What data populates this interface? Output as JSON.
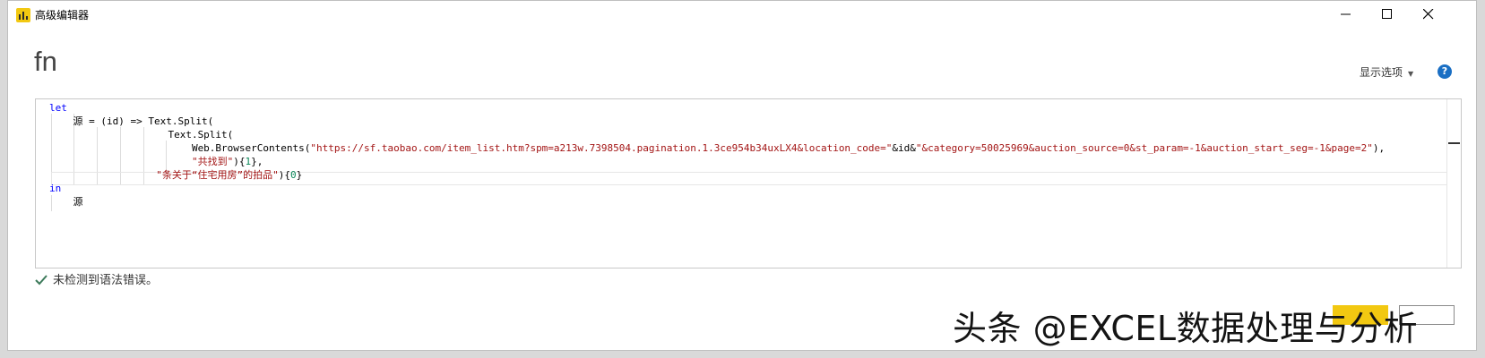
{
  "window": {
    "title": "高级编辑器",
    "minimize_icon": "minimize-icon",
    "maximize_icon": "maximize-icon",
    "close_icon": "close-icon"
  },
  "header": {
    "fn_label": "fn",
    "display_options": "显示选项",
    "help_glyph": "?"
  },
  "editor": {
    "lines": [
      {
        "seg": [
          {
            "t": "let",
            "c": "kw"
          }
        ]
      },
      {
        "seg": [
          {
            "t": "    源 = (id) => Text.Split(",
            "c": ""
          }
        ]
      },
      {
        "seg": [
          {
            "t": "                    Text.Split(",
            "c": ""
          }
        ]
      },
      {
        "seg": [
          {
            "t": "                        Web.BrowserContents(",
            "c": ""
          },
          {
            "t": "\"https://sf.taobao.com/item_list.htm?spm=a213w.7398504.pagination.1.3ce954b34uxLX4&location_code=\"",
            "c": "str"
          },
          {
            "t": "&id&",
            "c": ""
          },
          {
            "t": "\"&category=50025969&auction_source=0&st_param=-1&auction_start_seg=-1&page=2\"",
            "c": "str"
          },
          {
            "t": "),",
            "c": ""
          }
        ]
      },
      {
        "seg": [
          {
            "t": "                        ",
            "c": ""
          },
          {
            "t": "\"共找到\"",
            "c": "str"
          },
          {
            "t": "){",
            "c": ""
          },
          {
            "t": "1",
            "c": "num"
          },
          {
            "t": "},",
            "c": ""
          }
        ]
      },
      {
        "seg": [
          {
            "t": "                  ",
            "c": ""
          },
          {
            "t": "\"条关于“住宅用房”的拍品\"",
            "c": "str"
          },
          {
            "t": "){",
            "c": ""
          },
          {
            "t": "0",
            "c": "num"
          },
          {
            "t": "}",
            "c": ""
          }
        ]
      },
      {
        "seg": [
          {
            "t": "in",
            "c": "kw"
          }
        ]
      },
      {
        "seg": [
          {
            "t": "    源",
            "c": ""
          }
        ]
      }
    ]
  },
  "status": {
    "check_icon": "checkmark-icon",
    "text": "未检测到语法错误。"
  },
  "watermark": "头条 @EXCEL数据处理与分析",
  "colors": {
    "keyword": "#0000ff",
    "string": "#a31515",
    "number": "#098658",
    "accent": "#f2c811",
    "help": "#1a6fc4"
  }
}
